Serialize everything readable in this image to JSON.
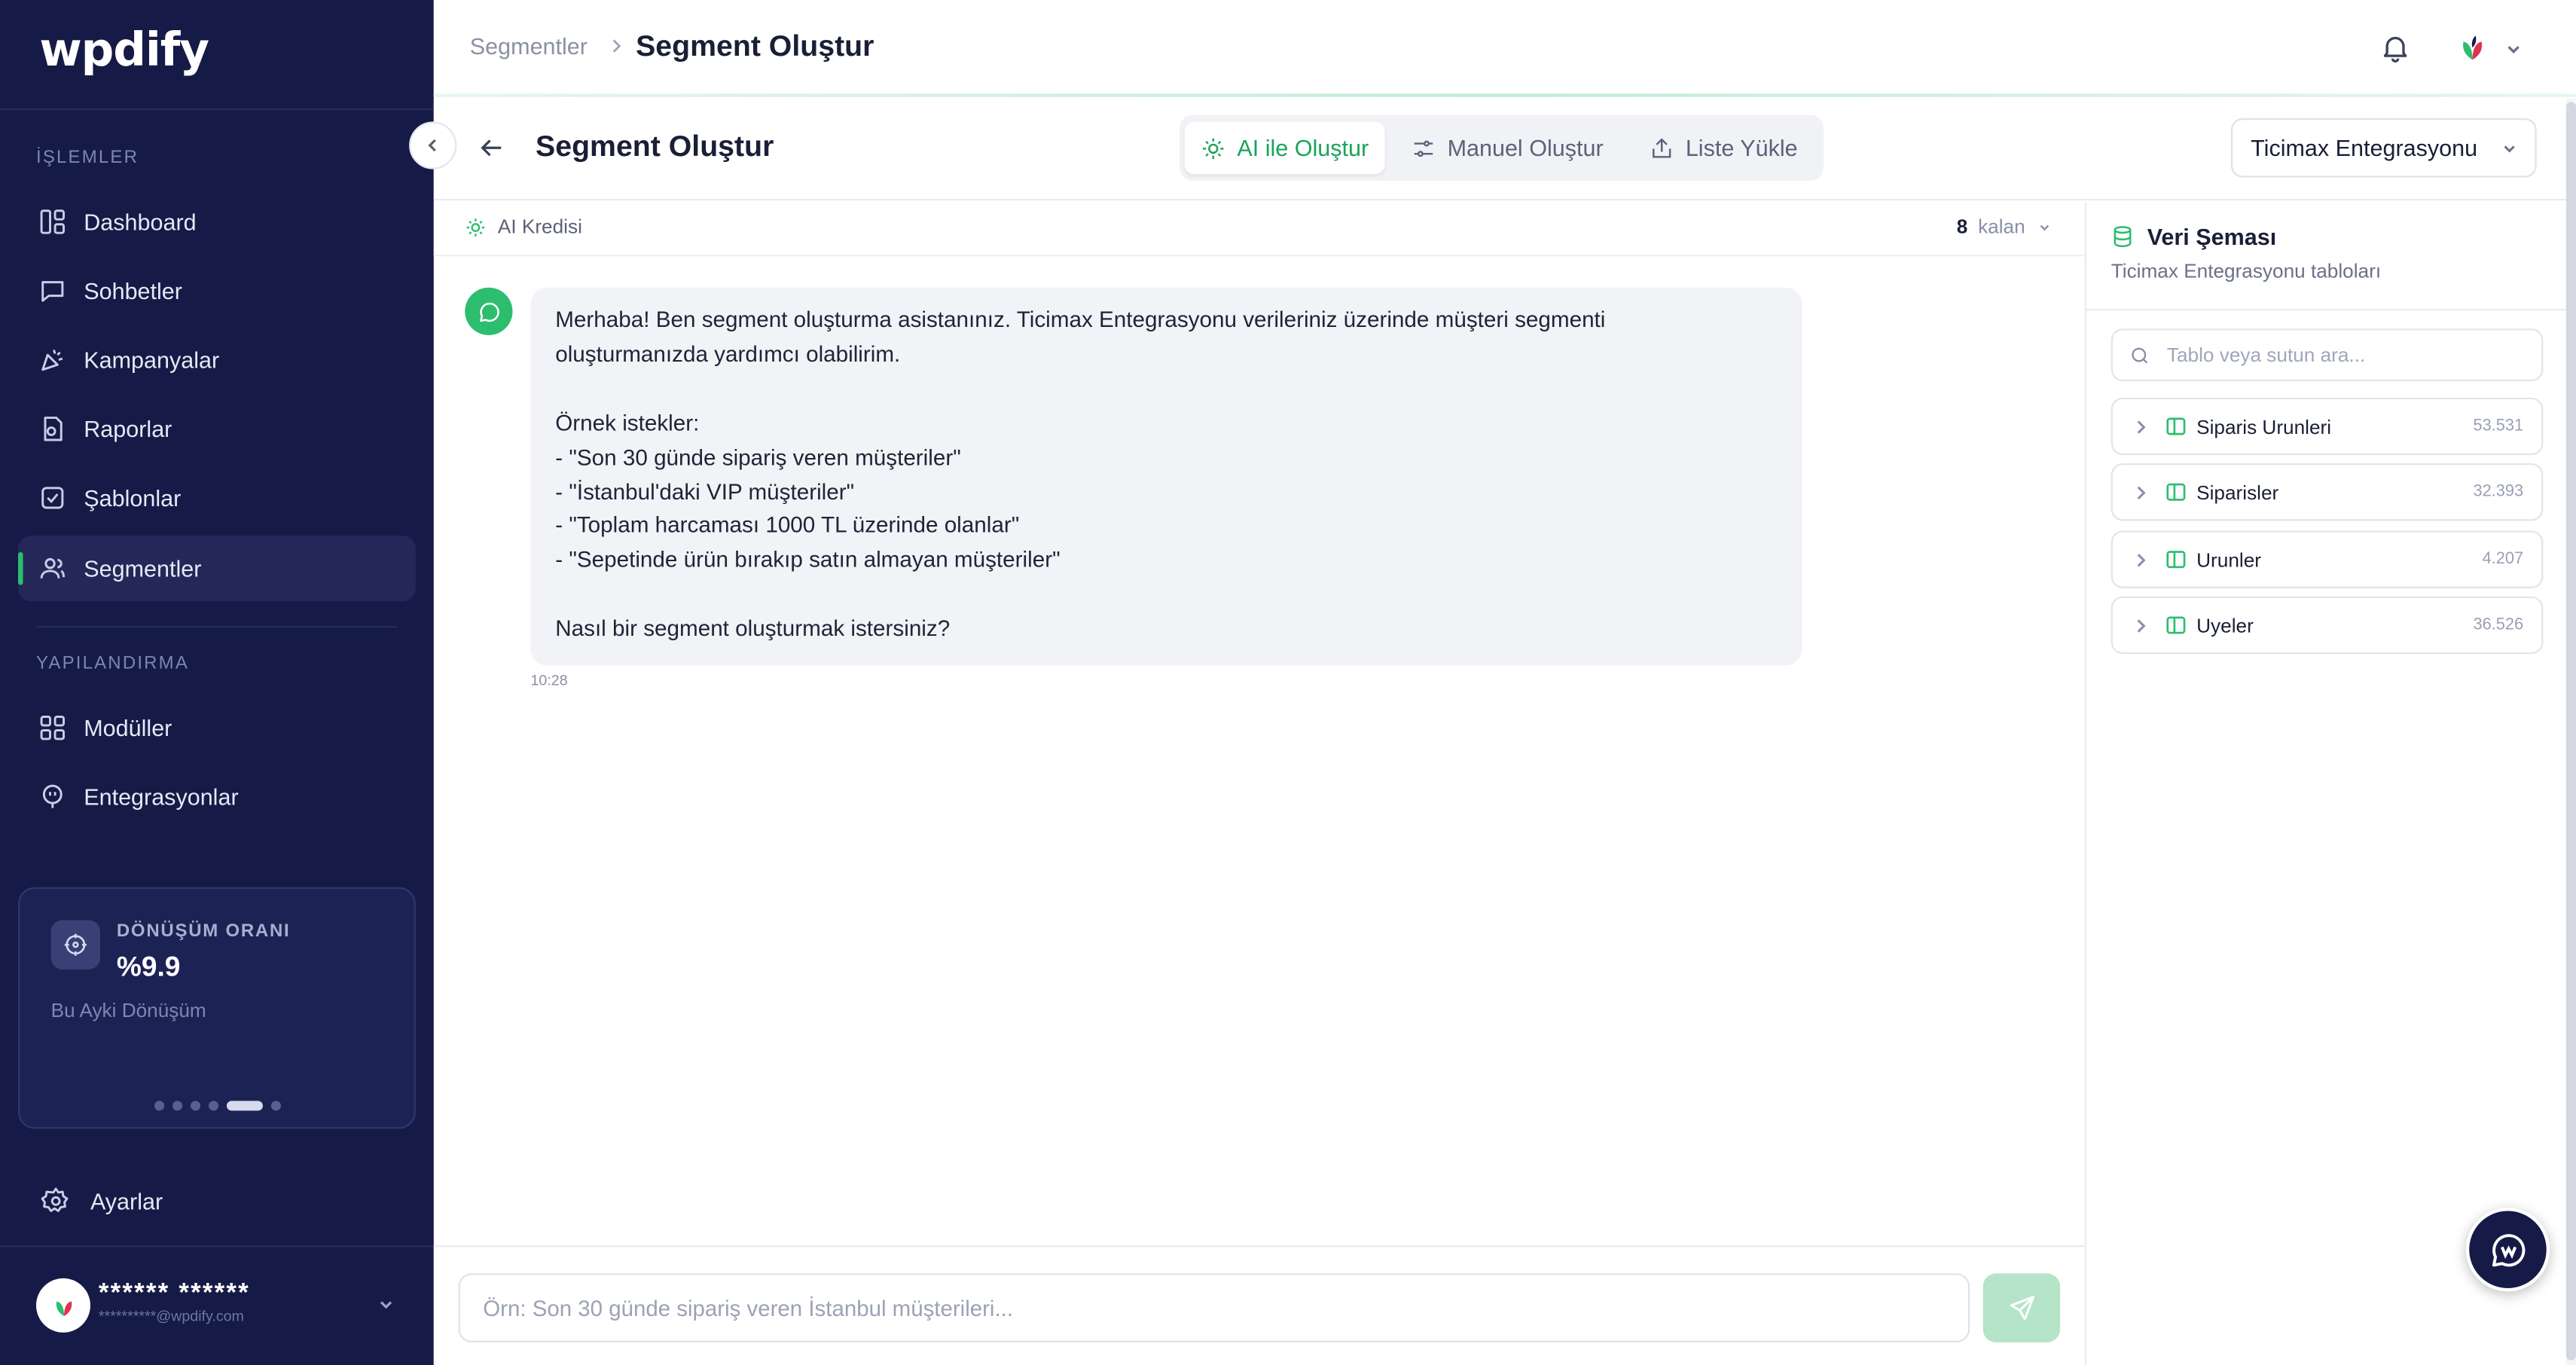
{
  "brand": {
    "logo": "wpdify"
  },
  "sidebar": {
    "section_operations": "İŞLEMLER",
    "section_config": "YAPILANDIRMA",
    "items": [
      {
        "label": "Dashboard",
        "icon": "dashboard-icon"
      },
      {
        "label": "Sohbetler",
        "icon": "chat-icon"
      },
      {
        "label": "Kampanyalar",
        "icon": "megaphone-icon"
      },
      {
        "label": "Raporlar",
        "icon": "report-icon"
      },
      {
        "label": "Şablonlar",
        "icon": "template-icon"
      },
      {
        "label": "Segmentler",
        "icon": "users-icon",
        "active": true
      },
      {
        "label": "Modüller",
        "icon": "grid-icon"
      },
      {
        "label": "Entegrasyonlar",
        "icon": "plug-icon"
      }
    ],
    "stats_card": {
      "label": "DÖNÜŞÜM ORANI",
      "value": "%9.9",
      "sub": "Bu Ayki Dönüşüm",
      "active_slide": 5,
      "slides": 6
    },
    "settings_label": "Ayarlar",
    "user": {
      "name": "****** ******",
      "email": "**********@wpdify.com"
    }
  },
  "topbar": {
    "breadcrumb_parent": "Segmentler",
    "breadcrumb_current": "Segment Oluştur"
  },
  "header": {
    "title": "Segment Oluştur",
    "tabs": [
      {
        "label": "AI ile Oluştur",
        "icon": "sparkle-icon",
        "selected": true
      },
      {
        "label": "Manuel Oluştur",
        "icon": "sliders-icon",
        "selected": false
      },
      {
        "label": "Liste Yükle",
        "icon": "upload-icon",
        "selected": false
      }
    ],
    "integration_select": "Ticimax Entegrasyonu"
  },
  "credits": {
    "label": "AI Kredisi",
    "count": "8",
    "suffix": "kalan"
  },
  "chat": {
    "message_lines": [
      "Merhaba! Ben segment oluşturma asistanınız. Ticimax Entegrasyonu verileriniz üzerinde müşteri segmenti",
      "oluşturmanızda yardımcı olabilirim.",
      "",
      "Örnek istekler:",
      "- \"Son 30 günde sipariş veren müşteriler\"",
      "- \"İstanbul'daki VIP müşteriler\"",
      "- \"Toplam harcaması 1000 TL üzerinde olanlar\"",
      "- \"Sepetinde ürün bırakıp satın almayan müşteriler\"",
      "",
      "Nasıl bir segment oluşturmak istersiniz?"
    ],
    "time": "10:28",
    "input_placeholder": "Örn: Son 30 günde sipariş veren İstanbul müşterileri..."
  },
  "schema": {
    "title": "Veri Şeması",
    "subtitle": "Ticimax Entegrasyonu tabloları",
    "search_placeholder": "Tablo veya sutun ara...",
    "tables": [
      {
        "name": "Siparis Urunleri",
        "count": "53.531"
      },
      {
        "name": "Siparisler",
        "count": "32.393"
      },
      {
        "name": "Urunler",
        "count": "4.207"
      },
      {
        "name": "Uyeler",
        "count": "36.526"
      }
    ]
  },
  "colors": {
    "sidebar": "#151a46",
    "accent": "#2dbd6e",
    "accent_text": "#1ba35a"
  }
}
